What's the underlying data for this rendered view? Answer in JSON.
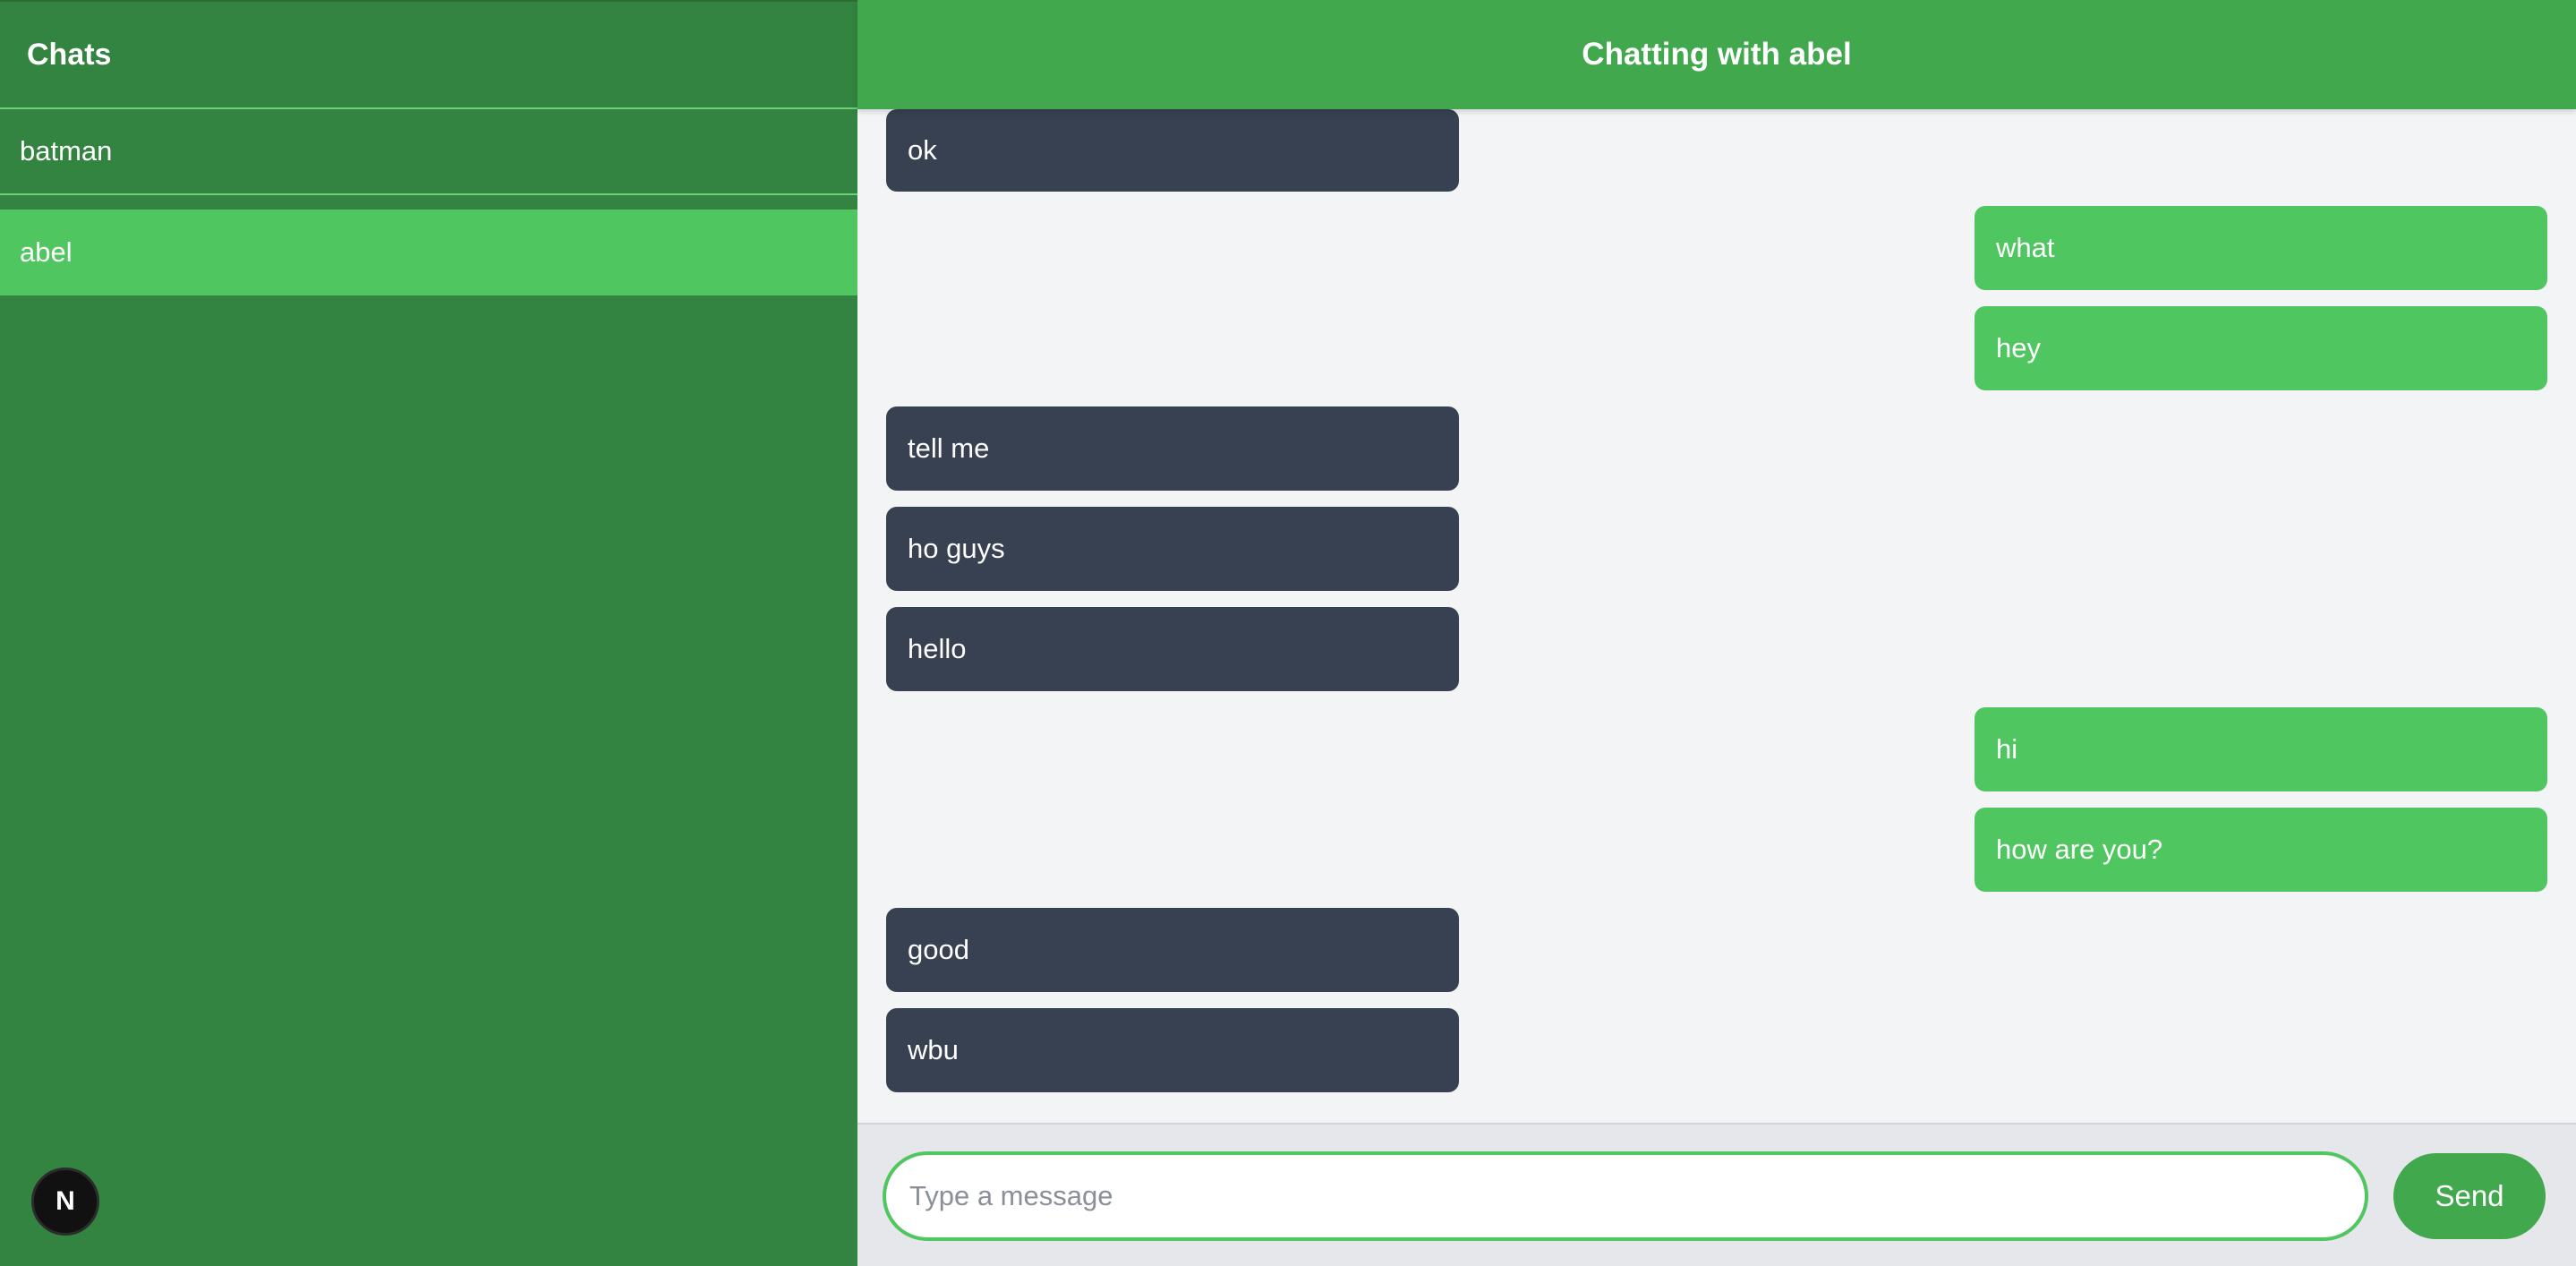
{
  "sidebar": {
    "title": "Chats",
    "chats": [
      {
        "name": "batman",
        "active": false
      },
      {
        "name": "abel",
        "active": true
      }
    ],
    "badge_letter": "N"
  },
  "header": {
    "title": "Chatting with abel"
  },
  "messages": [
    {
      "text": "ok",
      "from": "received"
    },
    {
      "text": "what",
      "from": "sent"
    },
    {
      "text": "hey",
      "from": "sent"
    },
    {
      "text": "tell me",
      "from": "received"
    },
    {
      "text": "ho guys",
      "from": "received"
    },
    {
      "text": "hello",
      "from": "received"
    },
    {
      "text": "hi",
      "from": "sent"
    },
    {
      "text": "how are you?",
      "from": "sent"
    },
    {
      "text": "good",
      "from": "received"
    },
    {
      "text": "wbu",
      "from": "received"
    }
  ],
  "composer": {
    "placeholder": "Type a message",
    "value": "",
    "send_label": "Send"
  },
  "colors": {
    "sidebar_bg": "#338440",
    "active_chat": "#50c660",
    "header_bg": "#42a84e",
    "received_bubble": "#374151",
    "sent_bubble": "#50c660"
  }
}
